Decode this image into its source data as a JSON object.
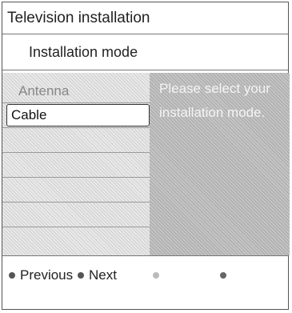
{
  "header": {
    "title": "Television installation",
    "subtitle": "Installation mode"
  },
  "menu": {
    "items": [
      {
        "label": "Antenna",
        "selected": false
      },
      {
        "label": "Cable",
        "selected": true
      }
    ]
  },
  "info": {
    "text": "Please select your installation mode."
  },
  "footer": {
    "previous_label": "Previous",
    "next_label": "Next",
    "colors": {
      "red": "#555555",
      "green": "#555555",
      "yellow": "#bbbbbb",
      "blue": "#666666"
    }
  }
}
